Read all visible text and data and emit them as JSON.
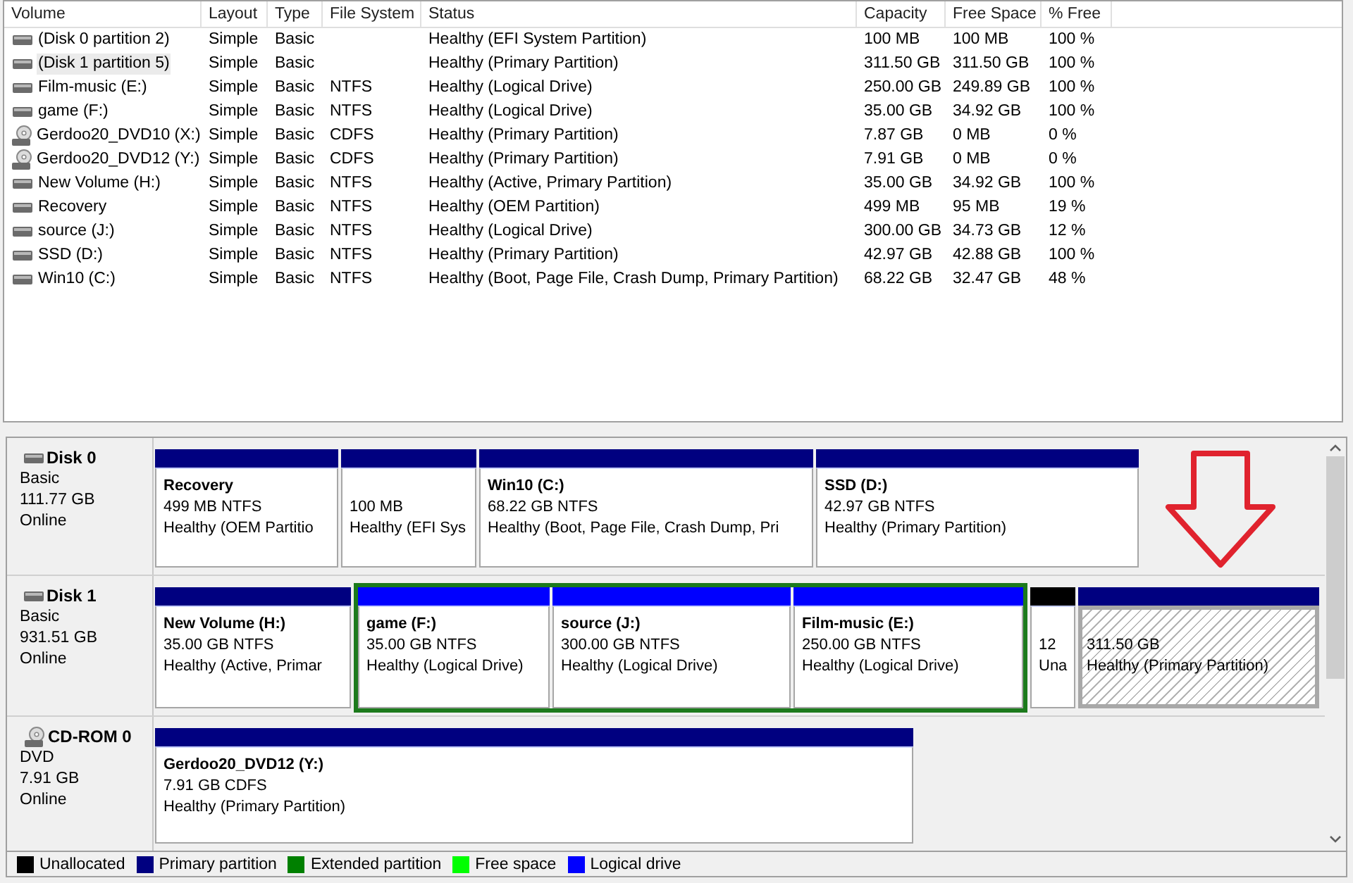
{
  "volume_list": {
    "columns": [
      "Volume",
      "Layout",
      "Type",
      "File System",
      "Status",
      "Capacity",
      "Free Space",
      "% Free"
    ],
    "rows": [
      {
        "kind": "disk",
        "selected": false,
        "volume": "(Disk 0 partition 2)",
        "layout": "Simple",
        "type": "Basic",
        "status": "Healthy (EFI System Partition)",
        "capacity": "100 MB",
        "free_space": "100 MB",
        "percent_free": "100 %"
      },
      {
        "kind": "disk",
        "selected": true,
        "volume": "(Disk 1 partition 5)",
        "layout": "Simple",
        "type": "Basic",
        "status": "Healthy (Primary Partition)",
        "capacity": "311.50 GB",
        "free_space": "311.50 GB",
        "percent_free": "100 %"
      },
      {
        "kind": "disk",
        "selected": false,
        "volume": "Film-music (E:)",
        "layout": "Simple",
        "type": "Basic",
        "file_system": "NTFS",
        "status": "Healthy (Logical Drive)",
        "capacity": "250.00 GB",
        "free_space": "249.89 GB",
        "percent_free": "100 %"
      },
      {
        "kind": "disk",
        "selected": false,
        "volume": "game (F:)",
        "layout": "Simple",
        "type": "Basic",
        "file_system": "NTFS",
        "status": "Healthy (Logical Drive)",
        "capacity": "35.00 GB",
        "free_space": "34.92 GB",
        "percent_free": "100 %"
      },
      {
        "kind": "cdrom",
        "selected": false,
        "volume": "Gerdoo20_DVD10 (X:)",
        "layout": "Simple",
        "type": "Basic",
        "file_system": "CDFS",
        "status": "Healthy (Primary Partition)",
        "capacity": "7.87 GB",
        "free_space": "0 MB",
        "percent_free": "0 %"
      },
      {
        "kind": "cdrom",
        "selected": false,
        "volume": "Gerdoo20_DVD12 (Y:)",
        "layout": "Simple",
        "type": "Basic",
        "file_system": "CDFS",
        "status": "Healthy (Primary Partition)",
        "capacity": "7.91 GB",
        "free_space": "0 MB",
        "percent_free": "0 %"
      },
      {
        "kind": "disk",
        "selected": false,
        "volume": "New Volume (H:)",
        "layout": "Simple",
        "type": "Basic",
        "file_system": "NTFS",
        "status": "Healthy (Active, Primary Partition)",
        "capacity": "35.00 GB",
        "free_space": "34.92 GB",
        "percent_free": "100 %"
      },
      {
        "kind": "disk",
        "selected": false,
        "volume": "Recovery",
        "layout": "Simple",
        "type": "Basic",
        "file_system": "NTFS",
        "status": "Healthy (OEM Partition)",
        "capacity": "499 MB",
        "free_space": "95 MB",
        "percent_free": "19 %"
      },
      {
        "kind": "disk",
        "selected": false,
        "volume": "source (J:)",
        "layout": "Simple",
        "type": "Basic",
        "file_system": "NTFS",
        "status": "Healthy (Logical Drive)",
        "capacity": "300.00 GB",
        "free_space": "34.73 GB",
        "percent_free": "12 %"
      },
      {
        "kind": "disk",
        "selected": false,
        "volume": "SSD (D:)",
        "layout": "Simple",
        "type": "Basic",
        "file_system": "NTFS",
        "status": "Healthy (Primary Partition)",
        "capacity": "42.97 GB",
        "free_space": "42.88 GB",
        "percent_free": "100 %"
      },
      {
        "kind": "disk",
        "selected": false,
        "volume": "Win10 (C:)",
        "layout": "Simple",
        "type": "Basic",
        "file_system": "NTFS",
        "status": "Healthy (Boot, Page File, Crash Dump, Primary Partition)",
        "capacity": "68.22 GB",
        "free_space": "32.47 GB",
        "percent_free": "48 %"
      }
    ]
  },
  "disk_map": {
    "disks": [
      {
        "kind": "disk",
        "name": "Disk 0",
        "type": "Basic",
        "size": "111.77 GB",
        "status": "Online",
        "partitions": [
          {
            "kind": "primary",
            "selected": false,
            "name": "Recovery",
            "size": "499 MB NTFS",
            "status": "Healthy (OEM Partitio"
          },
          {
            "kind": "primary",
            "selected": false,
            "size": "100 MB",
            "status": "Healthy (EFI Sys"
          },
          {
            "kind": "primary",
            "selected": false,
            "name": "Win10 (C:)",
            "size": "68.22 GB NTFS",
            "status": "Healthy (Boot, Page File, Crash Dump, Pri"
          },
          {
            "kind": "primary",
            "selected": false,
            "name": "SSD (D:)",
            "size": "42.97 GB NTFS",
            "status": "Healthy (Primary Partition)"
          }
        ]
      },
      {
        "kind": "disk",
        "name": "Disk 1",
        "type": "Basic",
        "size": "931.51 GB",
        "status": "Online",
        "partitions": [
          {
            "kind": "primary",
            "selected": false,
            "name": "New Volume (H:)",
            "size": "35.00 GB NTFS",
            "status": "Healthy (Active, Primar"
          },
          {
            "kind": "extended",
            "children": [
              {
                "kind": "logical",
                "selected": false,
                "name": "game (F:)",
                "size": "35.00 GB NTFS",
                "status": "Healthy (Logical Drive)"
              },
              {
                "kind": "logical",
                "selected": false,
                "name": "source (J:)",
                "size": "300.00 GB NTFS",
                "status": "Healthy (Logical Drive)"
              },
              {
                "kind": "logical",
                "selected": false,
                "name": "Film-music (E:)",
                "size": "250.00 GB NTFS",
                "status": "Healthy (Logical Drive)"
              }
            ]
          },
          {
            "kind": "unallocated",
            "selected": false,
            "size": "12",
            "status": "Una"
          },
          {
            "kind": "primary",
            "selected": true,
            "size": "311.50 GB",
            "status": "Healthy (Primary Partition)"
          }
        ]
      },
      {
        "kind": "cdrom",
        "name": "CD-ROM 0",
        "type": "DVD",
        "size": "7.91 GB",
        "status": "Online",
        "partitions": [
          {
            "kind": "primary",
            "selected": false,
            "name": "Gerdoo20_DVD12 (Y:)",
            "size": "7.91 GB CDFS",
            "status": "Healthy (Primary Partition)"
          }
        ]
      }
    ]
  },
  "legend": [
    {
      "label": "Unallocated",
      "color": "#000000"
    },
    {
      "label": "Primary partition",
      "color": "#000080"
    },
    {
      "label": "Extended partition",
      "color": "#008000"
    },
    {
      "label": "Free space",
      "color": "#00ff00"
    },
    {
      "label": "Logical drive",
      "color": "#0000ff"
    }
  ]
}
